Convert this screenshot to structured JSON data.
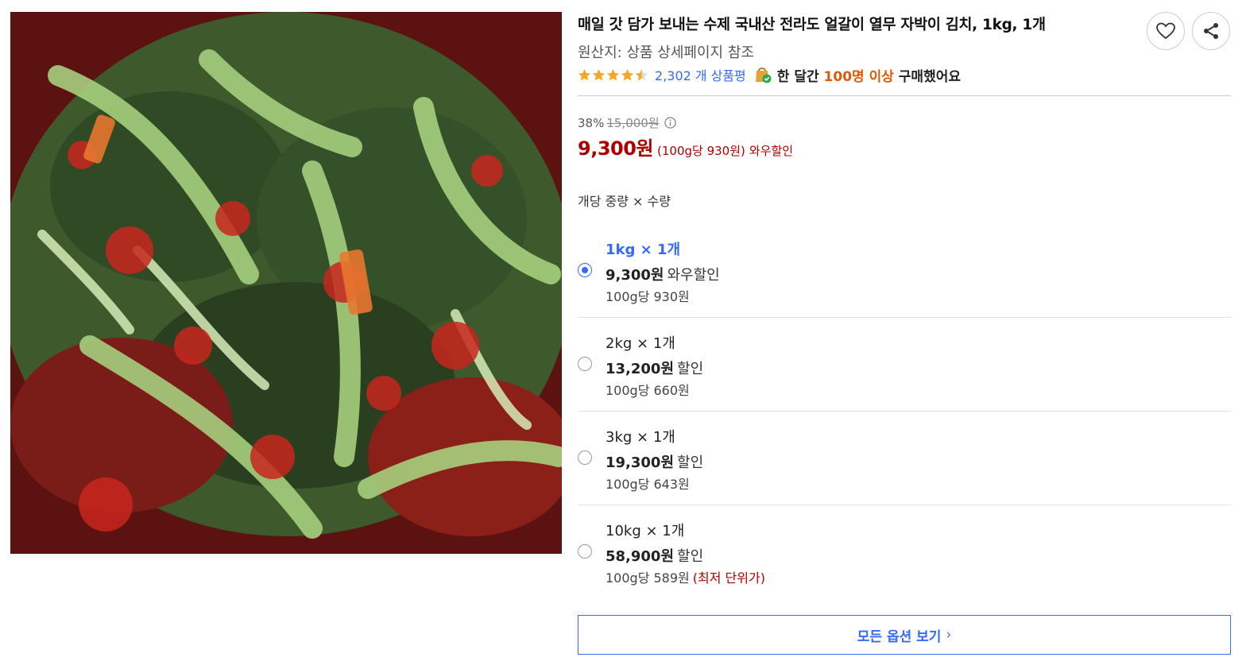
{
  "product": {
    "title": "매일 갓 담가 보내는 수제 국내산 전라도 얼갈이 열무 자박이 김치, 1kg, 1개",
    "origin": "원산지: 상품 상세페이지 참조",
    "rating": 4.5,
    "review_count": "2,302",
    "review_suffix": "개 상품평",
    "purchase_prefix": "한 달간",
    "purchase_highlight": "100명 이상",
    "purchase_suffix": "구매했어요"
  },
  "price": {
    "discount_rate": "38%",
    "original": "15,000원",
    "current": "9,300원",
    "unit_price": "(100g당 930원)",
    "badge": "와우할인"
  },
  "options": {
    "header": "개당 중량 × 수량",
    "items": [
      {
        "name": "1kg × 1개",
        "price": "9,300원",
        "tag": "와우할인",
        "unit": "100g당 930원",
        "note": "",
        "selected": true
      },
      {
        "name": "2kg × 1개",
        "price": "13,200원",
        "tag": "할인",
        "unit": "100g당 660원",
        "note": "",
        "selected": false
      },
      {
        "name": "3kg × 1개",
        "price": "19,300원",
        "tag": "할인",
        "unit": "100g당 643원",
        "note": "",
        "selected": false
      },
      {
        "name": "10kg × 1개",
        "price": "58,900원",
        "tag": "할인",
        "unit": "100g당 589원",
        "note": "(최저 단위가)",
        "selected": false
      }
    ],
    "view_all_label": "모든 옵션 보기",
    "view_all_chevron": "›"
  },
  "icons": {
    "wishlist": "heart-icon",
    "share": "share-icon",
    "rating": "star-icon",
    "purchase": "shopping-bag-check-icon",
    "info": "info-icon"
  },
  "colors": {
    "accent": "#346aff",
    "price": "#ae0000",
    "star": "#f5a623",
    "highlight": "#e0590b"
  }
}
